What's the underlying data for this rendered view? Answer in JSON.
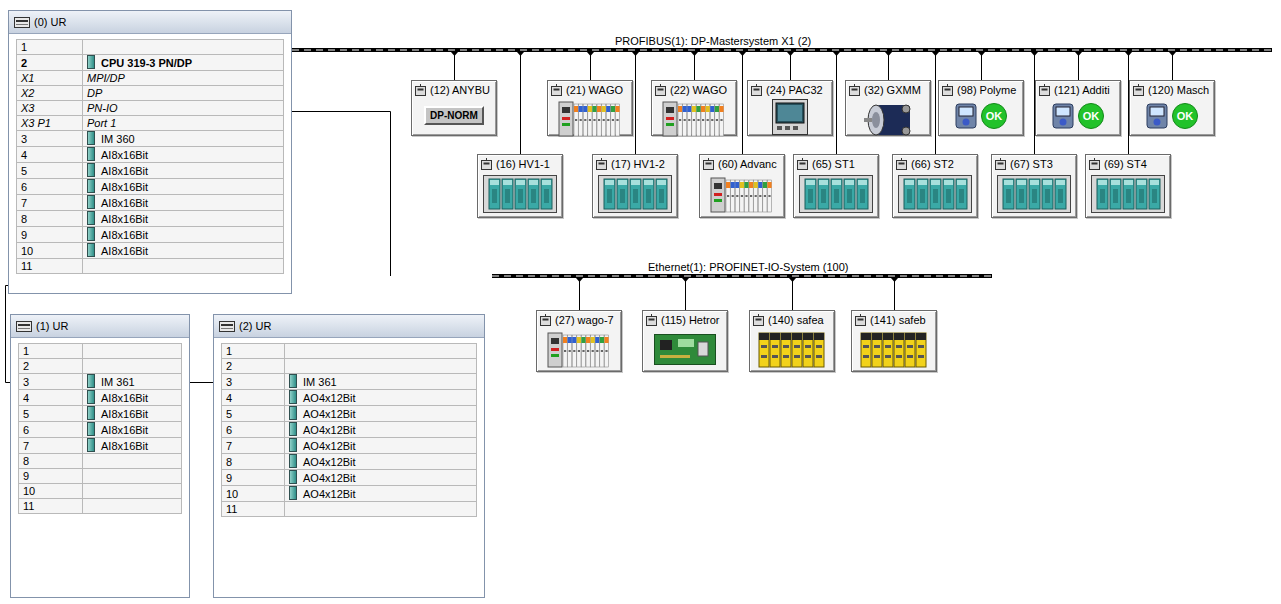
{
  "racks": [
    {
      "title": "(0) UR",
      "rows": [
        {
          "slot": "1",
          "kind": "empty"
        },
        {
          "slot": "2",
          "module": "CPU 319-3 PN/DP",
          "kind": "cpu"
        },
        {
          "slot": "X1",
          "module": "MPI/DP",
          "kind": "interface"
        },
        {
          "slot": "X2",
          "module": "DP",
          "kind": "interface"
        },
        {
          "slot": "X3",
          "module": "PN-IO",
          "kind": "interface"
        },
        {
          "slot": "X3 P1",
          "module": "Port 1",
          "kind": "interface"
        },
        {
          "slot": "3",
          "module": "IM 360",
          "kind": "module"
        },
        {
          "slot": "4",
          "module": "AI8x16Bit",
          "kind": "module"
        },
        {
          "slot": "5",
          "module": "AI8x16Bit",
          "kind": "module"
        },
        {
          "slot": "6",
          "module": "AI8x16Bit",
          "kind": "module"
        },
        {
          "slot": "7",
          "module": "AI8x16Bit",
          "kind": "module"
        },
        {
          "slot": "8",
          "module": "AI8x16Bit",
          "kind": "module"
        },
        {
          "slot": "9",
          "module": "AI8x16Bit",
          "kind": "module"
        },
        {
          "slot": "10",
          "module": "AI8x16Bit",
          "kind": "module"
        },
        {
          "slot": "11",
          "kind": "empty"
        }
      ]
    },
    {
      "title": "(1) UR",
      "rows": [
        {
          "slot": "1",
          "kind": "empty"
        },
        {
          "slot": "2",
          "kind": "empty"
        },
        {
          "slot": "3",
          "module": "IM 361",
          "kind": "module"
        },
        {
          "slot": "4",
          "module": "AI8x16Bit",
          "kind": "module"
        },
        {
          "slot": "5",
          "module": "AI8x16Bit",
          "kind": "module"
        },
        {
          "slot": "6",
          "module": "AI8x16Bit",
          "kind": "module"
        },
        {
          "slot": "7",
          "module": "AI8x16Bit",
          "kind": "module"
        },
        {
          "slot": "8",
          "kind": "empty"
        },
        {
          "slot": "9",
          "kind": "empty"
        },
        {
          "slot": "10",
          "kind": "empty"
        },
        {
          "slot": "11",
          "kind": "empty"
        }
      ]
    },
    {
      "title": "(2) UR",
      "rows": [
        {
          "slot": "1",
          "kind": "empty"
        },
        {
          "slot": "2",
          "kind": "empty"
        },
        {
          "slot": "3",
          "module": "IM 361",
          "kind": "module"
        },
        {
          "slot": "4",
          "module": "AO4x12Bit",
          "kind": "module"
        },
        {
          "slot": "5",
          "module": "AO4x12Bit",
          "kind": "module"
        },
        {
          "slot": "6",
          "module": "AO4x12Bit",
          "kind": "module"
        },
        {
          "slot": "7",
          "module": "AO4x12Bit",
          "kind": "module"
        },
        {
          "slot": "8",
          "module": "AO4x12Bit",
          "kind": "module"
        },
        {
          "slot": "9",
          "module": "AO4x12Bit",
          "kind": "module"
        },
        {
          "slot": "10",
          "module": "AO4x12Bit",
          "kind": "module"
        },
        {
          "slot": "11",
          "kind": "empty"
        }
      ]
    }
  ],
  "profibus": {
    "label": "PROFIBUS(1): DP-Mastersystem X1 (2)",
    "devices": [
      {
        "title": "(12) ANYBU",
        "kind": "dp-norm",
        "text": "DP-NORM"
      },
      {
        "title": "(21) WAGO",
        "kind": "wago"
      },
      {
        "title": "(22) WAGO",
        "kind": "wago"
      },
      {
        "title": "(24) PAC32",
        "kind": "panel"
      },
      {
        "title": "(32) GXMM",
        "kind": "encoder"
      },
      {
        "title": "(98) Polyme",
        "kind": "ok",
        "text": "OK"
      },
      {
        "title": "(121) Additi",
        "kind": "ok",
        "text": "OK"
      },
      {
        "title": "(120) Masch",
        "kind": "ok",
        "text": "OK"
      },
      {
        "title": "(16) HV1-1",
        "kind": "rack"
      },
      {
        "title": "(17) HV1-2",
        "kind": "rack"
      },
      {
        "title": "(60) Advanc",
        "kind": "wago"
      },
      {
        "title": "(65) ST1",
        "kind": "rack"
      },
      {
        "title": "(66) ST2",
        "kind": "rack"
      },
      {
        "title": "(67) ST3",
        "kind": "rack"
      },
      {
        "title": "(69) ST4",
        "kind": "rack"
      }
    ]
  },
  "profinet": {
    "label": "Ethernet(1): PROFINET-IO-System (100)",
    "devices": [
      {
        "title": "(27) wago-7",
        "kind": "wago"
      },
      {
        "title": "(115) Hetror",
        "kind": "board"
      },
      {
        "title": "(140) safea",
        "kind": "safety"
      },
      {
        "title": "(141) safeb",
        "kind": "safety"
      }
    ]
  }
}
